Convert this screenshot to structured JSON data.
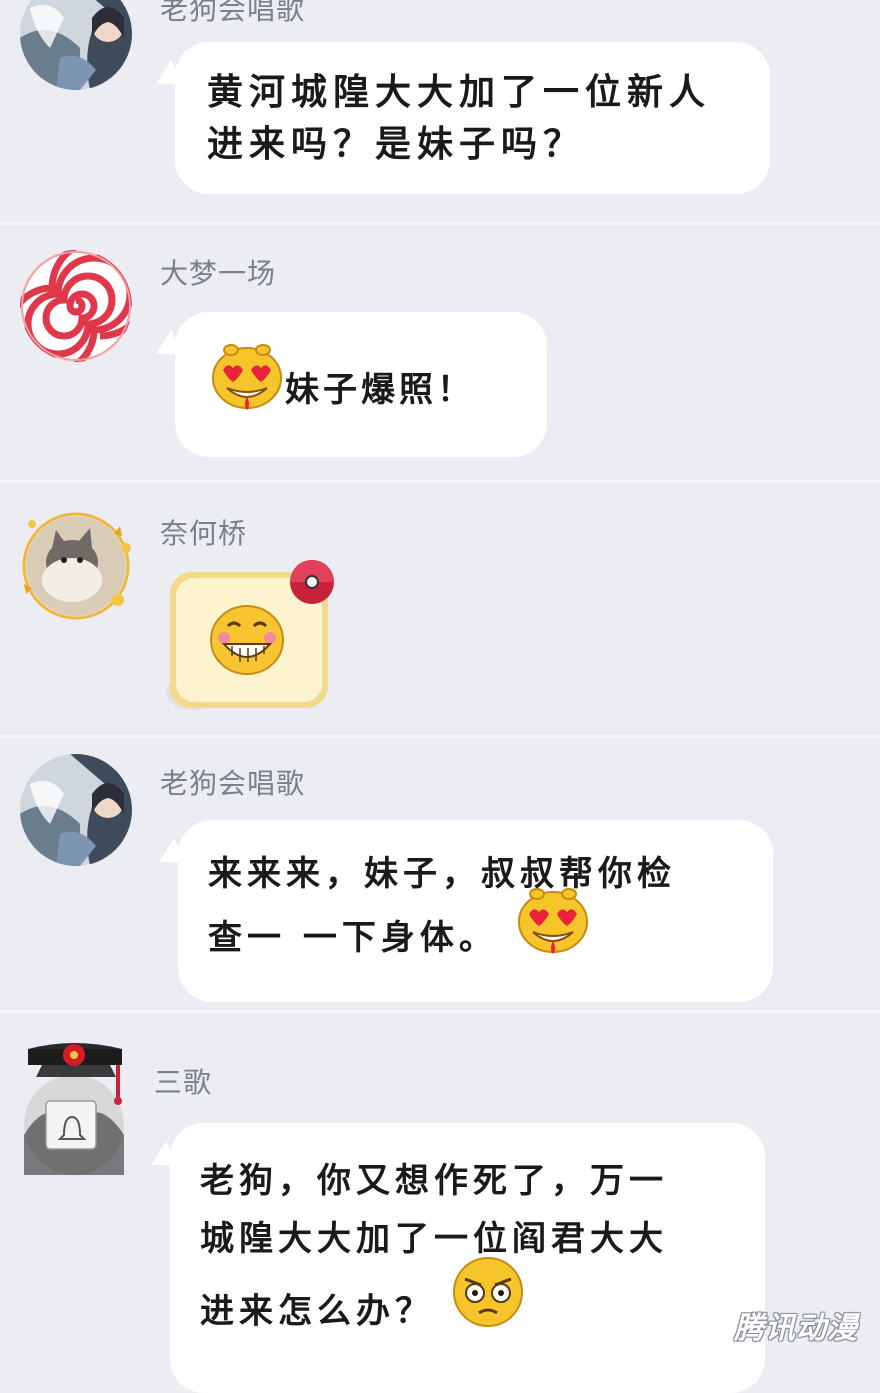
{
  "messages": [
    {
      "sender": "老狗会唱歌",
      "avatar_icon": "anime-girl-avatar",
      "lines": [
        "黄河城隍大大加了一位新人",
        "进来吗？是妹子吗？"
      ]
    },
    {
      "sender": "大梦一场",
      "avatar_icon": "lollipop-avatar",
      "emoji": "heart-eyes-emoji",
      "text": "妹子爆照！"
    },
    {
      "sender": "奈何桥",
      "avatar_icon": "cat-avatar",
      "sticker": "grin-sticker"
    },
    {
      "sender": "老狗会唱歌",
      "avatar_icon": "anime-girl-avatar",
      "lines": [
        "来来来，妹子，叔叔帮你检",
        "查一 一下身体。"
      ],
      "emoji": "heart-eyes-emoji"
    },
    {
      "sender": "三歌",
      "avatar_icon": "emperor-hat-avatar",
      "lines": [
        "老狗，你又想作死了，万一",
        "城隍大大加了一位阎君大大",
        "进来怎么办？"
      ],
      "emoji": "glaring-emoji"
    }
  ],
  "watermark": "腾讯动漫",
  "colors": {
    "background": "#ebedf2",
    "bubble": "#ffffff",
    "sender_name": "#7b7f88",
    "text": "#1a1a1a"
  }
}
